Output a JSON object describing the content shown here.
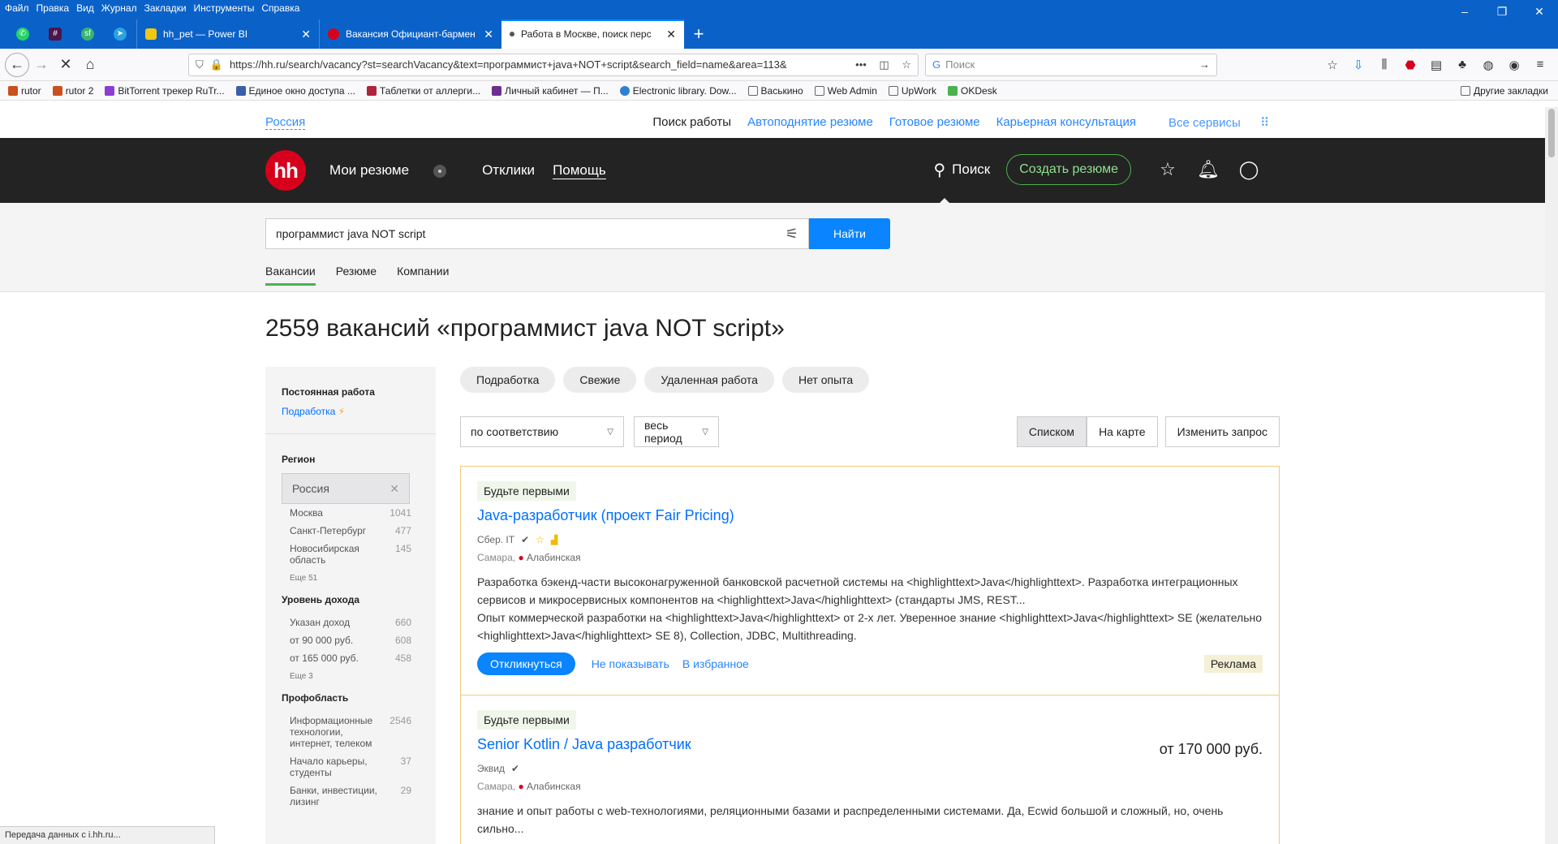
{
  "browser": {
    "menu": [
      "Файл",
      "Правка",
      "Вид",
      "Журнал",
      "Закладки",
      "Инструменты",
      "Справка"
    ],
    "window_controls": [
      "–",
      "❐",
      "✕"
    ],
    "tabs": [
      {
        "title": "hh_pet — Power BI",
        "close": "✕"
      },
      {
        "title": "Вакансия Официант-бармен",
        "close": "✕"
      },
      {
        "title": "Работа в Москве, поиск перс",
        "close": "✕"
      }
    ],
    "new_tab": "+",
    "url": "https://hh.ru/search/vacancy?st=searchVacancy&text=программист+java+NOT+script&search_field=name&area=113&",
    "search_placeholder": "Поиск",
    "bookmarks": [
      "rutor",
      "rutor 2",
      "BitTorrent трекер RuTr...",
      "Единое окно доступа ...",
      "Таблетки от аллерги...",
      "Личный кабинет — П...",
      "Electronic library. Dow...",
      "Васькино",
      "Web Admin",
      "UpWork",
      "OKDesk"
    ],
    "bookmarks_other": "Другие закладки",
    "status": "Передача данных с i.hh.ru..."
  },
  "site": {
    "region": "Россия",
    "top_links": [
      "Поиск работы",
      "Автоподнятие резюме",
      "Готовое резюме",
      "Карьерная консультация",
      "Все сервисы"
    ],
    "logo": "hh",
    "nav": {
      "resumes": "Мои резюме",
      "responses": "Отклики",
      "help": "Помощь"
    },
    "search_label": "Поиск",
    "create_resume": "Создать резюме"
  },
  "search": {
    "query": "программист java NOT script",
    "find_button": "Найти",
    "tabs": [
      "Вакансии",
      "Резюме",
      "Компании"
    ]
  },
  "results_title": "2559 вакансий «программист java NOT script»",
  "sidebar": {
    "employment": {
      "title": "Постоянная работа",
      "link": "Подработка",
      "bolt": "⚡"
    },
    "region": {
      "title": "Регион",
      "items": [
        {
          "name": "Россия",
          "count": "✕"
        },
        {
          "name": "Москва",
          "count": "1041"
        },
        {
          "name": "Санкт-Петербург",
          "count": "477"
        },
        {
          "name": "Новосибирская область",
          "count": "145"
        }
      ],
      "more": "Еще 51"
    },
    "income": {
      "title": "Уровень дохода",
      "items": [
        {
          "name": "Указан доход",
          "count": "660"
        },
        {
          "name": "от 90 000 руб.",
          "count": "608"
        },
        {
          "name": "от 165 000 руб.",
          "count": "458"
        }
      ],
      "more": "Еще 3"
    },
    "profarea": {
      "title": "Профобласть",
      "items": [
        {
          "name": "Информационные технологии, интернет, телеком",
          "count": "2546"
        },
        {
          "name": "Начало карьеры, студенты",
          "count": "37"
        },
        {
          "name": "Банки, инвестиции, лизинг",
          "count": "29"
        }
      ]
    }
  },
  "chips": [
    "Подработка",
    "Свежие",
    "Удаленная работа",
    "Нет опыта"
  ],
  "sort": {
    "order": "по соответствию",
    "period": "весь период"
  },
  "view": {
    "list": "Списком",
    "map": "На карте",
    "change": "Изменить запрос"
  },
  "vacancies": [
    {
      "badge": "Будьте первыми",
      "title": "Java-разработчик (проект Fair Pricing)",
      "salary": "",
      "company": "Сбер. IT",
      "city": "Самара,",
      "metro": "Алабинская",
      "desc1": "Разработка бэкенд-части высоконагруженной банковской расчетной системы на <highlighttext>Java</highlighttext>. Разработка интеграционных сервисов и микросервисных компонентов на <highlighttext>Java</highlighttext> (стандарты JMS, REST...",
      "desc2": "Опыт коммерческой разработки на <highlighttext>Java</highlighttext> от 2-х лет. Уверенное знание <highlighttext>Java</highlighttext> SE (желательно <highlighttext>Java</highlighttext> SE 8), Collection, JDBC, Multithreading.",
      "respond": "Откликнуться",
      "hide": "Не показывать",
      "fav": "В избранное",
      "ad": "Реклама"
    },
    {
      "badge": "Будьте первыми",
      "title": "Senior Kotlin / Java разработчик",
      "salary": "от 170 000 руб.",
      "company": "Эквид",
      "city": "Самара,",
      "metro": "Алабинская",
      "desc1": "знание и опыт работы с web-технологиями, реляционными базами и распределенными системами. Да, Ecwid большой и сложный, но, очень сильно..."
    }
  ]
}
